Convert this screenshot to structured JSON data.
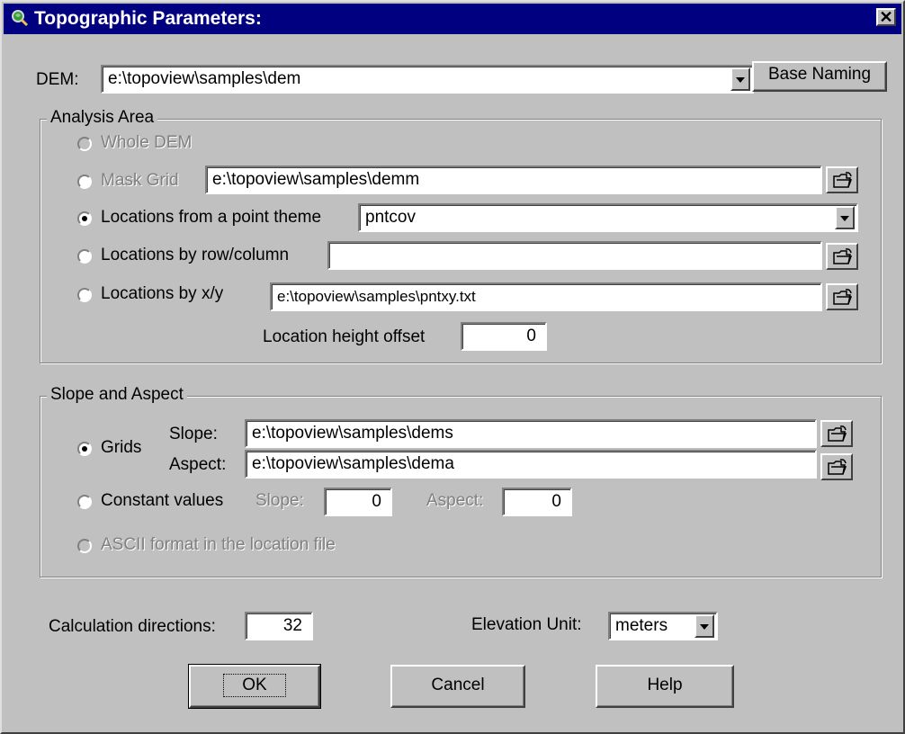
{
  "window": {
    "title": "Topographic Parameters:",
    "close_symbol": "✕"
  },
  "dem": {
    "label": "DEM:",
    "value": "e:\\topoview\\samples\\dem",
    "base_naming_label": "Base Naming"
  },
  "analysis_area": {
    "title": "Analysis Area",
    "whole_dem_label": "Whole DEM",
    "mask_grid_label": "Mask Grid",
    "mask_grid_value": "e:\\topoview\\samples\\demm",
    "point_theme_label": "Locations from a point theme",
    "point_theme_value": "pntcov",
    "row_col_label": "Locations by row/column",
    "row_col_value": "",
    "xy_label": "Locations by x/y",
    "xy_value": "e:\\topoview\\samples\\pntxy.txt",
    "height_offset_label": "Location height offset",
    "height_offset_value": "0",
    "selected": "point_theme"
  },
  "slope_aspect": {
    "title": "Slope and Aspect",
    "grids_label": "Grids",
    "slope_label": "Slope:",
    "slope_value": "e:\\topoview\\samples\\dems",
    "aspect_label": "Aspect:",
    "aspect_value": "e:\\topoview\\samples\\dema",
    "constant_label": "Constant values",
    "const_slope_label": "Slope:",
    "const_slope_value": "0",
    "const_aspect_label": "Aspect:",
    "const_aspect_value": "0",
    "ascii_label": "ASCII format in the location file",
    "selected": "grids"
  },
  "calc_directions": {
    "label": "Calculation directions:",
    "value": "32"
  },
  "elevation_unit": {
    "label": "Elevation Unit:",
    "value": "meters"
  },
  "buttons": {
    "ok": "OK",
    "cancel": "Cancel",
    "help": "Help"
  },
  "colors": {
    "title_bar": "#000080",
    "face": "#c0c0c0",
    "disabled_text": "#808080"
  },
  "icons": {
    "app": "magnifier-globe-icon",
    "browse": "open-folder-icon",
    "dropdown": "chevron-down-icon",
    "close": "close-icon"
  }
}
